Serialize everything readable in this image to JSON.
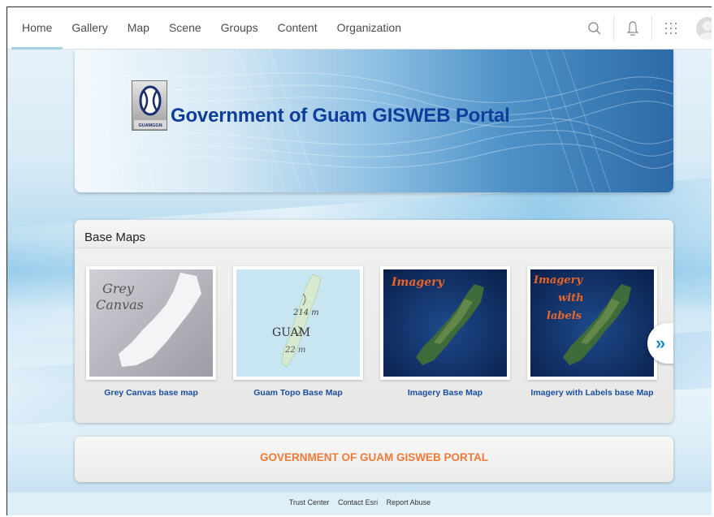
{
  "nav": {
    "items": [
      "Home",
      "Gallery",
      "Map",
      "Scene",
      "Groups",
      "Content",
      "Organization"
    ],
    "active": "Home",
    "icons": [
      "search-icon",
      "bell-icon",
      "app-grid-icon",
      "avatar"
    ]
  },
  "banner": {
    "title": "Government of Guam GISWEB Portal",
    "logo_text": "GUAMGGN"
  },
  "base_maps": {
    "heading": "Base Maps",
    "cards": [
      {
        "title": "Grey Canvas base map",
        "thumb_text": [
          "Grey",
          "Canvas"
        ]
      },
      {
        "title": "Guam Topo Base Map",
        "thumb_text": [
          "214 m",
          "GUAM",
          "22 m"
        ]
      },
      {
        "title": "Imagery Base Map",
        "thumb_text": [
          "Imagery"
        ]
      },
      {
        "title": "Imagery with Labels base Map",
        "thumb_text": [
          "Imagery",
          "with",
          "labels"
        ]
      }
    ],
    "next_icon": "double-chevron-right-icon"
  },
  "footer_banner": {
    "text": "GOVERNMENT OF GUAM GISWEB PORTAL"
  },
  "footer_links": [
    "Trust Center",
    "Contact Esri",
    "Report Abuse"
  ],
  "colors": {
    "title_blue": "#0e3e9a",
    "link_blue": "#1a4fa3",
    "footer_orange": "#f07a3a",
    "active_underline": "#a9cfe4"
  }
}
